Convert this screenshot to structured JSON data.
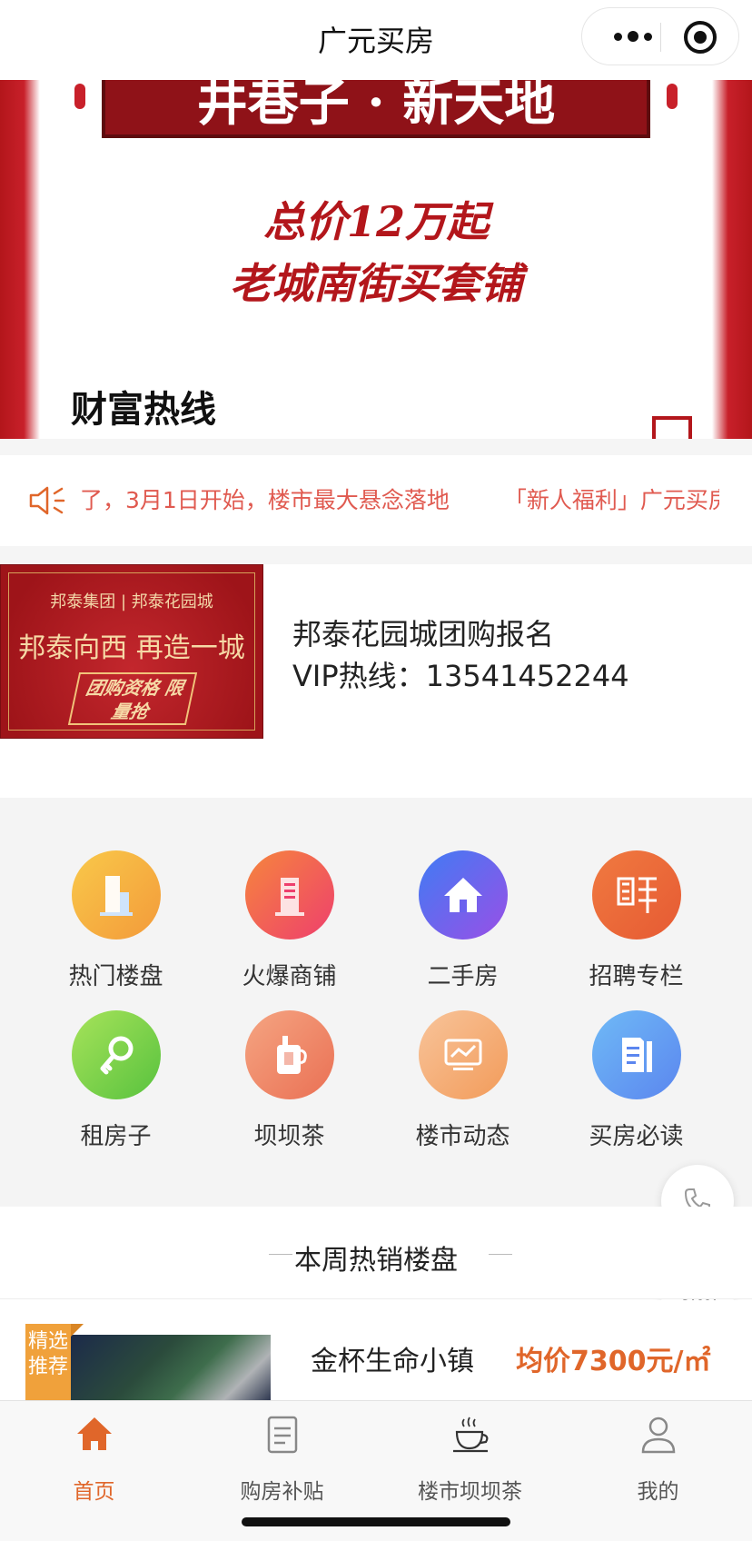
{
  "app": {
    "title": "广元买房"
  },
  "banner": {
    "plaque_text": "井巷子 · 新天地",
    "line1": "总价12万起",
    "line2": "老城南街买套铺",
    "hotline_label": "财富热线"
  },
  "notice": {
    "items": [
      "了，3月1日开始，楼市最大悬念落地",
      "「新人福利」广元买房"
    ]
  },
  "promo": {
    "thumb_brand": "邦泰集团 | 邦泰花园城",
    "thumb_slogan": "邦泰向西  再造一城",
    "thumb_badge": "团购资格 限量抢",
    "title": "邦泰花园城团购报名",
    "hotline": "VIP热线：13541452244"
  },
  "grid": {
    "items": [
      {
        "label": "热门楼盘",
        "icon": "building-icon",
        "color_from": "#f9c94a",
        "color_to": "#f39a3a"
      },
      {
        "label": "火爆商铺",
        "icon": "shop-building-icon",
        "color_from": "#f6863d",
        "color_to": "#ee3f6d"
      },
      {
        "label": "二手房",
        "icon": "house-icon",
        "color_from": "#3f7cf4",
        "color_to": "#9a4fe6"
      },
      {
        "label": "招聘专栏",
        "icon": "recruit-pin-icon",
        "color_from": "#f07a40",
        "color_to": "#e65a33"
      },
      {
        "label": "租房子",
        "icon": "key-icon",
        "color_from": "#a7e35a",
        "color_to": "#58c23e"
      },
      {
        "label": "坝坝茶",
        "icon": "tea-cup-icon",
        "color_from": "#f5a582",
        "color_to": "#ea7054"
      },
      {
        "label": "楼市动态",
        "icon": "monitor-chart-icon",
        "color_from": "#f8c49a",
        "color_to": "#f29b5a"
      },
      {
        "label": "买房必读",
        "icon": "document-icon",
        "color_from": "#6fbaf6",
        "color_to": "#5b86ef"
      }
    ]
  },
  "section": {
    "title": "本周热销楼盘"
  },
  "listing": {
    "tag": "精选推荐",
    "name": "金杯生命小镇",
    "price": "均价7300元/㎡"
  },
  "tabbar": {
    "tabs": [
      {
        "label": "首页",
        "icon": "home-icon",
        "active": true
      },
      {
        "label": "购房补贴",
        "icon": "document-list-icon",
        "active": false
      },
      {
        "label": "楼市坝坝茶",
        "icon": "coffee-cup-icon",
        "active": false
      },
      {
        "label": "我的",
        "icon": "user-icon",
        "active": false
      }
    ]
  },
  "colors": {
    "accent": "#e0662a",
    "banner_red": "#b3161b",
    "notice_text": "#e05a50",
    "grid_bg": "#f4f4f4"
  }
}
